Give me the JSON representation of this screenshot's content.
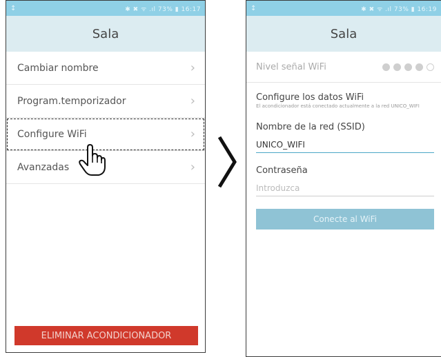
{
  "left": {
    "status": {
      "left_icon": "↕",
      "right": "✱ ✖ ᯤ .ıl 73% ▮ 16:17"
    },
    "title": "Sala",
    "menu": [
      {
        "label": "Cambiar nombre"
      },
      {
        "label": "Program.temporizador"
      },
      {
        "label": "Configure WiFi"
      },
      {
        "label": "Avanzadas"
      }
    ],
    "delete_button": "ELIMINAR ACONDICIONADOR"
  },
  "right": {
    "status": {
      "left_icon": "↕",
      "right": "✱ ✖ ᯤ .ıl 73% ▮ 16:19"
    },
    "title": "Sala",
    "wifi_level_label": "Nivel señal WiFi",
    "wifi_level": {
      "filled": 4,
      "total": 5
    },
    "config_title": "Configure los datos WiFi",
    "config_subtitle": "El acondicionador está conectado actualmente a la red UNICO_WIFI",
    "ssid_label": "Nombre de la red (SSID)",
    "ssid_value": "UNICO_WIFI",
    "password_label": "Contraseña",
    "password_placeholder": "Introduzca",
    "connect_button": "Conecte al WiFi"
  },
  "colors": {
    "statusbar": "#8fd0e6",
    "titlebar": "#dcecf1",
    "delete": "#d0392b",
    "connect": "#8fc3d5"
  },
  "icons": [
    "chevron-right-icon",
    "pointing-hand-icon",
    "navigation-arrow-icon",
    "signal-dot-icon"
  ]
}
